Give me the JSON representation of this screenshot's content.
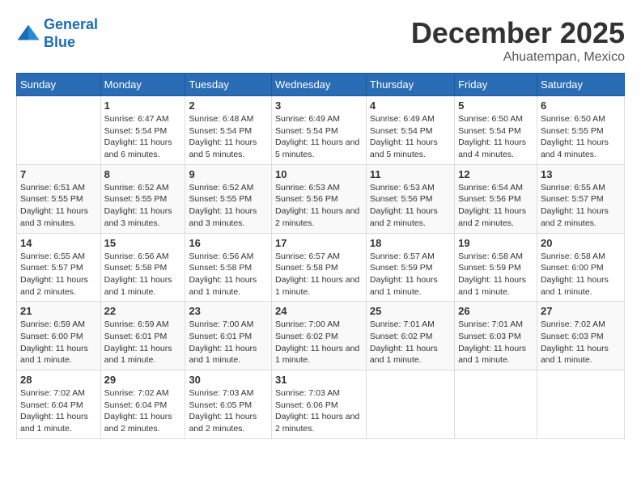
{
  "header": {
    "logo_line1": "General",
    "logo_line2": "Blue",
    "month": "December 2025",
    "location": "Ahuatempan, Mexico"
  },
  "weekdays": [
    "Sunday",
    "Monday",
    "Tuesday",
    "Wednesday",
    "Thursday",
    "Friday",
    "Saturday"
  ],
  "weeks": [
    [
      {
        "day": "",
        "info": ""
      },
      {
        "day": "1",
        "info": "Sunrise: 6:47 AM\nSunset: 5:54 PM\nDaylight: 11 hours and 6 minutes."
      },
      {
        "day": "2",
        "info": "Sunrise: 6:48 AM\nSunset: 5:54 PM\nDaylight: 11 hours and 5 minutes."
      },
      {
        "day": "3",
        "info": "Sunrise: 6:49 AM\nSunset: 5:54 PM\nDaylight: 11 hours and 5 minutes."
      },
      {
        "day": "4",
        "info": "Sunrise: 6:49 AM\nSunset: 5:54 PM\nDaylight: 11 hours and 5 minutes."
      },
      {
        "day": "5",
        "info": "Sunrise: 6:50 AM\nSunset: 5:54 PM\nDaylight: 11 hours and 4 minutes."
      },
      {
        "day": "6",
        "info": "Sunrise: 6:50 AM\nSunset: 5:55 PM\nDaylight: 11 hours and 4 minutes."
      }
    ],
    [
      {
        "day": "7",
        "info": "Sunrise: 6:51 AM\nSunset: 5:55 PM\nDaylight: 11 hours and 3 minutes."
      },
      {
        "day": "8",
        "info": "Sunrise: 6:52 AM\nSunset: 5:55 PM\nDaylight: 11 hours and 3 minutes."
      },
      {
        "day": "9",
        "info": "Sunrise: 6:52 AM\nSunset: 5:55 PM\nDaylight: 11 hours and 3 minutes."
      },
      {
        "day": "10",
        "info": "Sunrise: 6:53 AM\nSunset: 5:56 PM\nDaylight: 11 hours and 2 minutes."
      },
      {
        "day": "11",
        "info": "Sunrise: 6:53 AM\nSunset: 5:56 PM\nDaylight: 11 hours and 2 minutes."
      },
      {
        "day": "12",
        "info": "Sunrise: 6:54 AM\nSunset: 5:56 PM\nDaylight: 11 hours and 2 minutes."
      },
      {
        "day": "13",
        "info": "Sunrise: 6:55 AM\nSunset: 5:57 PM\nDaylight: 11 hours and 2 minutes."
      }
    ],
    [
      {
        "day": "14",
        "info": "Sunrise: 6:55 AM\nSunset: 5:57 PM\nDaylight: 11 hours and 2 minutes."
      },
      {
        "day": "15",
        "info": "Sunrise: 6:56 AM\nSunset: 5:58 PM\nDaylight: 11 hours and 1 minute."
      },
      {
        "day": "16",
        "info": "Sunrise: 6:56 AM\nSunset: 5:58 PM\nDaylight: 11 hours and 1 minute."
      },
      {
        "day": "17",
        "info": "Sunrise: 6:57 AM\nSunset: 5:58 PM\nDaylight: 11 hours and 1 minute."
      },
      {
        "day": "18",
        "info": "Sunrise: 6:57 AM\nSunset: 5:59 PM\nDaylight: 11 hours and 1 minute."
      },
      {
        "day": "19",
        "info": "Sunrise: 6:58 AM\nSunset: 5:59 PM\nDaylight: 11 hours and 1 minute."
      },
      {
        "day": "20",
        "info": "Sunrise: 6:58 AM\nSunset: 6:00 PM\nDaylight: 11 hours and 1 minute."
      }
    ],
    [
      {
        "day": "21",
        "info": "Sunrise: 6:59 AM\nSunset: 6:00 PM\nDaylight: 11 hours and 1 minute."
      },
      {
        "day": "22",
        "info": "Sunrise: 6:59 AM\nSunset: 6:01 PM\nDaylight: 11 hours and 1 minute."
      },
      {
        "day": "23",
        "info": "Sunrise: 7:00 AM\nSunset: 6:01 PM\nDaylight: 11 hours and 1 minute."
      },
      {
        "day": "24",
        "info": "Sunrise: 7:00 AM\nSunset: 6:02 PM\nDaylight: 11 hours and 1 minute."
      },
      {
        "day": "25",
        "info": "Sunrise: 7:01 AM\nSunset: 6:02 PM\nDaylight: 11 hours and 1 minute."
      },
      {
        "day": "26",
        "info": "Sunrise: 7:01 AM\nSunset: 6:03 PM\nDaylight: 11 hours and 1 minute."
      },
      {
        "day": "27",
        "info": "Sunrise: 7:02 AM\nSunset: 6:03 PM\nDaylight: 11 hours and 1 minute."
      }
    ],
    [
      {
        "day": "28",
        "info": "Sunrise: 7:02 AM\nSunset: 6:04 PM\nDaylight: 11 hours and 1 minute."
      },
      {
        "day": "29",
        "info": "Sunrise: 7:02 AM\nSunset: 6:04 PM\nDaylight: 11 hours and 2 minutes."
      },
      {
        "day": "30",
        "info": "Sunrise: 7:03 AM\nSunset: 6:05 PM\nDaylight: 11 hours and 2 minutes."
      },
      {
        "day": "31",
        "info": "Sunrise: 7:03 AM\nSunset: 6:06 PM\nDaylight: 11 hours and 2 minutes."
      },
      {
        "day": "",
        "info": ""
      },
      {
        "day": "",
        "info": ""
      },
      {
        "day": "",
        "info": ""
      }
    ]
  ]
}
